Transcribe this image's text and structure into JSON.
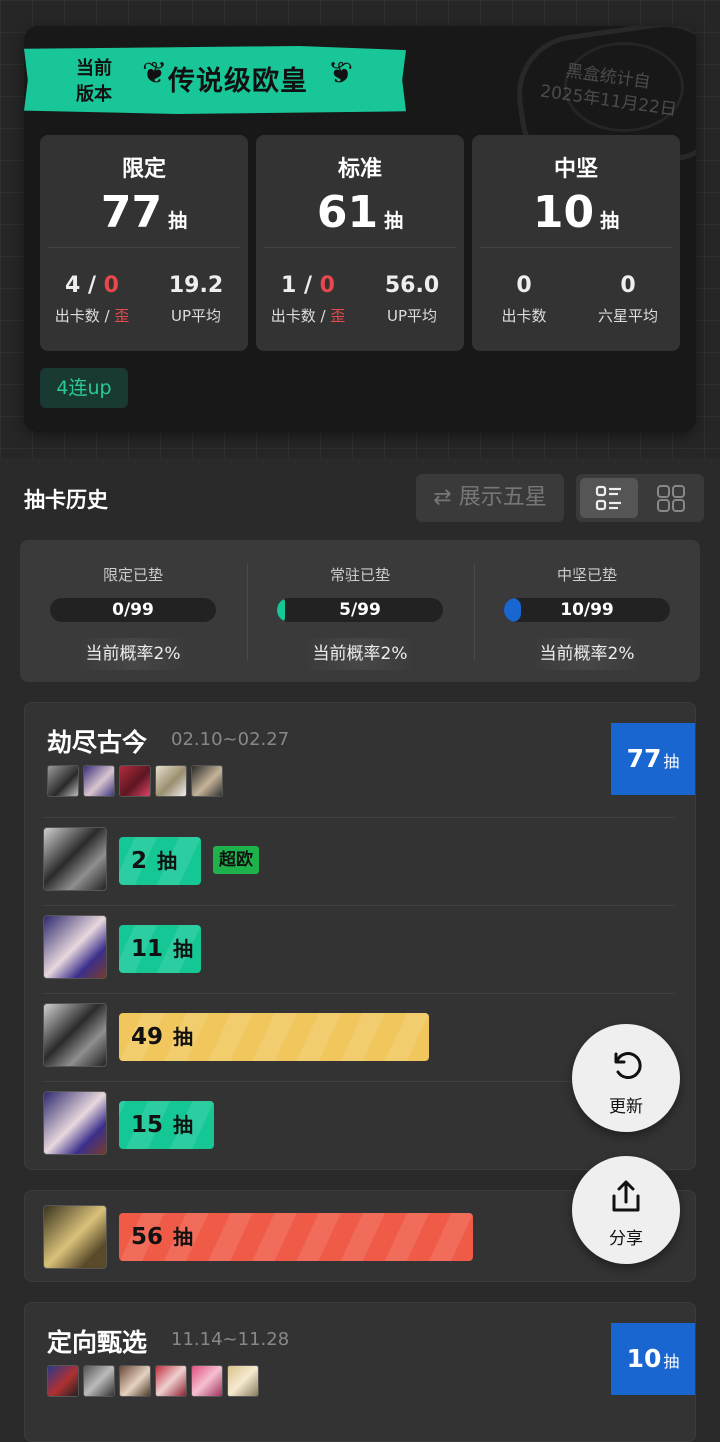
{
  "summary": {
    "banner_prefix_line1": "当前",
    "banner_prefix_line2": "版本",
    "banner_title": "传说级欧皇",
    "stamp_line1": "黑盒统计自",
    "stamp_line2": "2025年11月22日",
    "tag": "4连up",
    "stats": [
      {
        "title": "限定",
        "count": "77",
        "unit": "抽",
        "v1a": "4",
        "v1sep": " / ",
        "v1b": "0",
        "l1a": "出卡数 / ",
        "l1b": "歪",
        "v2": "19.2",
        "l2": "UP平均"
      },
      {
        "title": "标准",
        "count": "61",
        "unit": "抽",
        "v1a": "1",
        "v1sep": " / ",
        "v1b": "0",
        "l1a": "出卡数 / ",
        "l1b": "歪",
        "v2": "56.0",
        "l2": "UP平均"
      },
      {
        "title": "中坚",
        "count": "10",
        "unit": "抽",
        "v1a": "0",
        "v1sep": "",
        "v1b": "",
        "l1a": "出卡数",
        "l1b": "",
        "v2": "0",
        "l2": "六星平均"
      }
    ]
  },
  "history": {
    "title": "抽卡历史",
    "show_five_star_label": "⇄ 展示五星",
    "view_toggle": {
      "selected": "list"
    }
  },
  "pity": [
    {
      "title": "限定已垫",
      "value": "0/99",
      "fraction": 0.0,
      "fill_color": "#14c795",
      "rate": "当前概率2%"
    },
    {
      "title": "常驻已垫",
      "value": "5/99",
      "fraction": 0.0505,
      "fill_color": "#14c795",
      "rate": "当前概率2%"
    },
    {
      "title": "中坚已垫",
      "value": "10/99",
      "fraction": 0.101,
      "fill_color": "#1a66d0",
      "rate": "当前概率2%"
    }
  ],
  "pools": [
    {
      "name": "劫尽古今",
      "dates": "02.10~02.27",
      "count": "77",
      "unit": "抽",
      "rows": [
        {
          "num": "2",
          "unit": "抽",
          "fraction": 0.0202,
          "color": "green",
          "tag": "超欧"
        },
        {
          "num": "11",
          "unit": "抽",
          "fraction": 0.111,
          "color": "green",
          "tag": ""
        },
        {
          "num": "49",
          "unit": "抽",
          "fraction": 0.495,
          "color": "yellow",
          "tag": ""
        },
        {
          "num": "15",
          "unit": "抽",
          "fraction": 0.152,
          "color": "green",
          "tag": ""
        }
      ]
    },
    {
      "name": "",
      "dates": "",
      "count": "",
      "unit": "",
      "rows": [
        {
          "num": "56",
          "unit": "抽",
          "fraction": 0.566,
          "color": "red",
          "tag": ""
        }
      ]
    },
    {
      "name": "定向甄选",
      "dates": "11.14~11.28",
      "count": "10",
      "unit": "抽",
      "rows": []
    }
  ],
  "fabs": {
    "refresh": "更新",
    "share": "分享"
  },
  "colors": {
    "accent": "#19c697",
    "limited_count_bg": "#1a66d0",
    "red": "#e8484b",
    "tag_green": "#1eb24d"
  }
}
